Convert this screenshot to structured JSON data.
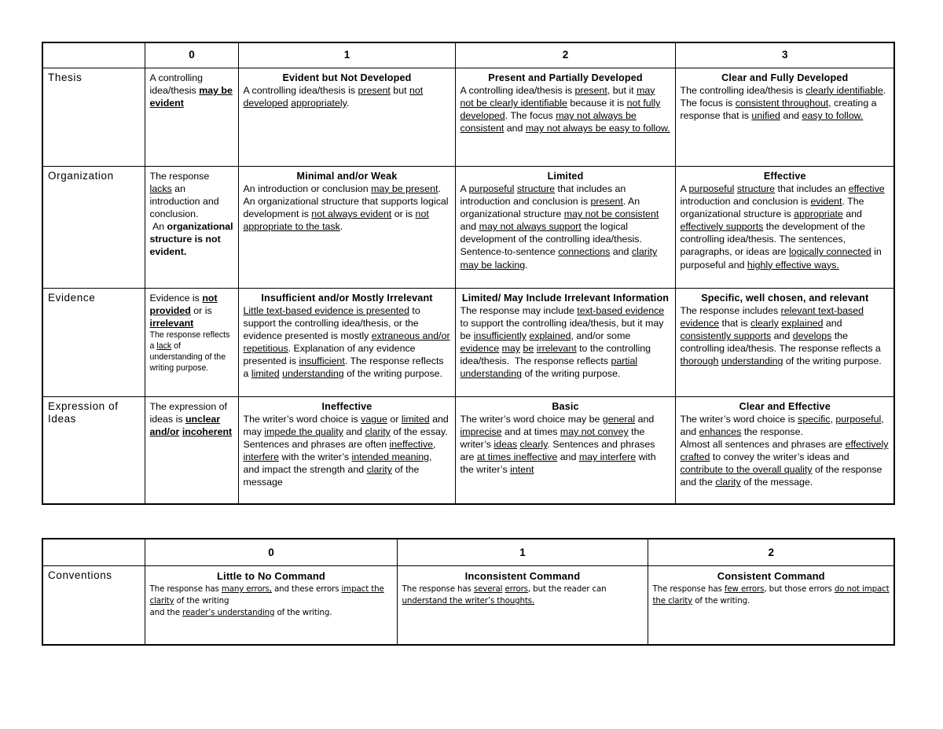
{
  "rubric": {
    "table1": {
      "name": "writing-rubric-main",
      "score_headers": [
        "0",
        "1",
        "2",
        "3"
      ],
      "rows": [
        {
          "label": "Thesis",
          "cells": [
            {
              "title": "",
              "body_html": "A controlling idea/thesis <b><u>may be evident</u></b>",
              "body_text": "A controlling idea/thesis may be evident"
            },
            {
              "title": "Evident but Not Developed",
              "body_html": "A controlling idea/thesis is <u>present</u> but <u>not developed</u> <u>appropriately</u>.",
              "body_text": "A controlling idea/thesis is present but not developed appropriately."
            },
            {
              "title": "Present and Partially Developed",
              "body_html": "A controlling idea/thesis is <u>present</u>, but it <u>may not be clearly identifiable</u> because it is <u>not fully developed</u>. The focus <u>may not always be consistent</u> and <u>may not always be easy to follow.</u>",
              "body_text": "A controlling idea/thesis is present, but it may not be clearly identifiable because it is not fully developed. The focus may not always be consistent and may not always be easy to follow."
            },
            {
              "title": "Clear and Fully Developed",
              "body_html": "The controlling idea/thesis is <u>clearly identifiable</u>. The focus is <u>consistent throughout,</u> creating a response that is <u>unified</u> and <u>easy to follow.</u>",
              "body_text": "The controlling idea/thesis is clearly identifiable. The focus is consistent throughout, creating a response that is unified and easy to follow."
            }
          ]
        },
        {
          "label": "Organization",
          "cells": [
            {
              "title": "",
              "body_html": "The response <u>lacks</u> an introduction and conclusion.<br>&nbsp;An <b>organizational structure is not evident.</b>",
              "body_text": "The response lacks an introduction and conclusion. An organizational structure is not evident."
            },
            {
              "title": "Minimal and/or Weak",
              "body_html": "An introduction or conclusion <u>may be present</u>. An organizational structure that supports logical development is <u>not always evident</u> or is <u>not appropriate to the task</u>.",
              "body_text": "An introduction or conclusion may be present. An organizational structure that supports logical development is not always evident or is not appropriate to the task."
            },
            {
              "title": "Limited",
              "body_html": "A <u>purposeful</u> <u>structure</u> that includes an introduction and conclusion is <u>present</u>. An organizational structure <u>may not be consistent</u> and <u>may not always support</u> the logical development of the controlling idea/thesis. Sentence-to-sentence <u>connections</u> and <u>clarity may be lacking</u>.",
              "body_text": "A purposeful structure that includes an introduction and conclusion is present. An organizational structure may not be consistent and may not always support the logical development of the controlling idea/thesis. Sentence-to-sentence connections and clarity may be lacking."
            },
            {
              "title": "Effective",
              "body_html": "A <u>purposeful</u> <u>structure</u> that includes an <u>effective</u> introduction and conclusion is <u>evident</u>. The organizational structure is <u>appropriate</u> and <u>effectively supports</u> the development of the controlling idea/thesis. The sentences, paragraphs, or ideas are <u>logically connected</u> in purposeful and <u>highly effective ways.</u>",
              "body_text": "A purposeful structure that includes an effective introduction and conclusion is evident. The organizational structure is appropriate and effectively supports the development of the controlling idea/thesis. The sentences, paragraphs, or ideas are logically connected in purposeful and highly effective ways."
            }
          ]
        },
        {
          "label": "Evidence",
          "cells": [
            {
              "title": "",
              "body_html": "Evidence is <b><u>not provided</u></b> or is <b><u>irrelevant</u></b><span class=\"small-para\">The response reflects a <u>lack</u> of understanding of the writing purpose.</span>",
              "body_text": "Evidence is not provided or is irrelevant The response reflects a lack of understanding of the writing purpose."
            },
            {
              "title": "Insufficient and/or Mostly Irrelevant",
              "body_html": "<u>Little text-based evidence is presented</u> to support the controlling idea/thesis, or the evidence presented is mostly <u>extraneous and/or repetitious</u>. Explanation of any evidence presented is <u>insufficient</u>. The response reflects a <u>limited</u> <u>understanding</u> of the writing purpose.",
              "body_text": "Little text-based evidence is presented to support the controlling idea/thesis, or the evidence presented is mostly extraneous and/or repetitious. Explanation of any evidence presented is insufficient. The response reflects a limited understanding of the writing purpose."
            },
            {
              "title": "Limited/ May Include Irrelevant Information",
              "body_html": "The response may include <u>text-based evidence</u> to support the controlling idea/thesis, but it may be <u>insufficiently</u> <u>explained</u>, and/or some <u>evidence</u> <u>may</u> <u>be</u> <u>irrelevant</u> to the controlling idea/thesis.&nbsp; The response reflects <u>partial understanding</u> of the writing purpose.",
              "body_text": "The response may include text-based evidence to support the controlling idea/thesis, but it may be insufficiently explained, and/or some evidence may be irrelevant to the controlling idea/thesis. The response reflects partial understanding of the writing purpose."
            },
            {
              "title": "Specific, well chosen, and relevant",
              "body_html": "The response includes <u>relevant text-based evidence</u> that is <u>clearly</u> <u>explained</u> and <u>consistently supports</u> and <u>develops</u> the controlling idea/thesis. The response reflects a <u>thorough</u> <u>understanding</u> of the writing purpose.",
              "body_text": "The response includes relevant text-based evidence that is clearly explained and consistently supports and develops the controlling idea/thesis. The response reflects a thorough understanding of the writing purpose."
            }
          ]
        },
        {
          "label": "Expression of Ideas",
          "cells": [
            {
              "title": "",
              "body_html": "The expression of ideas is <b><u>unclear and/or</u></b> <b><u>incoherent</u></b>",
              "body_text": "The expression of ideas is unclear and/or incoherent"
            },
            {
              "title": "Ineffective",
              "body_html": "The writer’s word choice is <u>vague</u> or <u>limited</u> and may <u>impede the quality</u> and <u>clarity</u> of the essay. Sentences and phrases are often <u>ineffective</u>, <u>interfere</u> with the writer’s <u>intended meaning</u>, and impact the strength and <u>clarity</u> of the message",
              "body_text": "The writer’s word choice is vague or limited and may impede the quality and clarity of the essay. Sentences and phrases are often ineffective, interfere with the writer’s intended meaning, and impact the strength and clarity of the message"
            },
            {
              "title": "Basic",
              "body_html": "The writer’s word choice may be <u>general</u> and <u>imprecise</u> and at times <u>may not convey</u> the writer’s <u>ideas</u> <u>clearly</u>. Sentences and phrases are <u>at times ineffective</u> and <u>may interfere</u> with the writer’s <u>intent</u>",
              "body_text": "The writer’s word choice may be general and imprecise and at times may not convey the writer’s ideas clearly. Sentences and phrases are at times ineffective and may interfere with the writer’s intent"
            },
            {
              "title": "Clear and Effective",
              "body_html": "The writer’s word choice is <u>specific</u>, <u>purposeful</u>, and <u>enhances</u> the response.<br>Almost all sentences and phrases are <u>effectively crafted</u> to convey the writer’s ideas and <u>contribute to the overall quality</u> of the response and the <u>clarity</u> of the message.",
              "body_text": "The writer’s word choice is specific, purposeful, and enhances the response. Almost all sentences and phrases are effectively crafted to convey the writer’s ideas and contribute to the overall quality of the response and the clarity of the message."
            }
          ]
        }
      ]
    },
    "table2": {
      "name": "conventions-rubric",
      "score_headers": [
        "0",
        "1",
        "2"
      ],
      "rows": [
        {
          "label": "Conventions",
          "cells": [
            {
              "title": "Little to No Command",
              "body_html": "The response has <u>many errors,</u> and these errors <u>impact the clarity</u> of the writing<br>and the <u>reader’s understanding</u> of the writing.",
              "body_text": "The response has many errors, and these errors impact the clarity of the writing and the reader’s understanding of the writing."
            },
            {
              "title": "Inconsistent Command",
              "body_html": "The response has <u>several</u> <u>errors</u>, but the reader can <u>understand the writer’s thoughts.</u>",
              "body_text": "The response has several errors, but the reader can understand the writer’s thoughts."
            },
            {
              "title": "Consistent Command",
              "body_html": "The response has <u>few errors</u>, but those errors <u>do not impact the clarity</u> of the writing.",
              "body_text": "The response has few errors, but those errors do not impact the clarity of the writing."
            }
          ]
        }
      ]
    }
  }
}
